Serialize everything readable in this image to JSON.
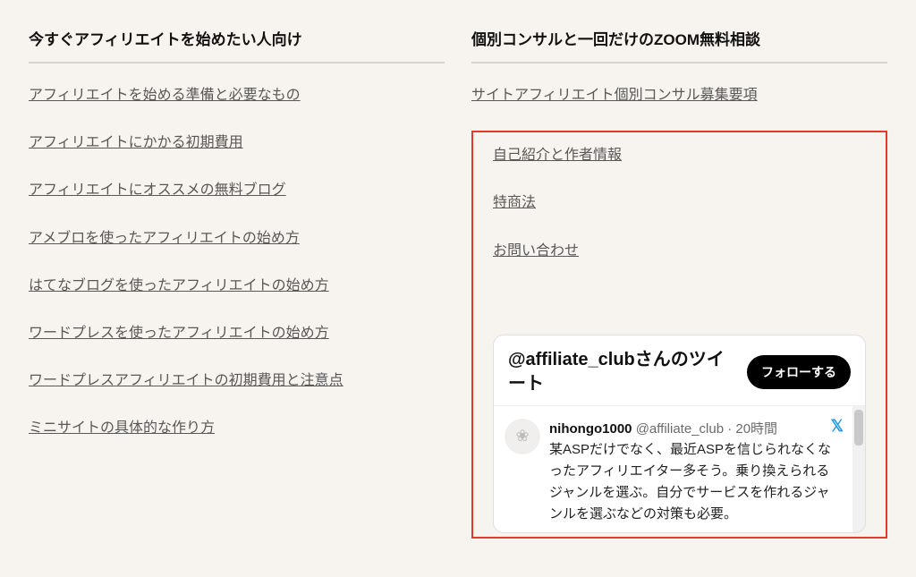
{
  "left": {
    "title": "今すぐアフィリエイトを始めたい人向け",
    "links": [
      "アフィリエイトを始める準備と必要なもの",
      "アフィリエイトにかかる初期費用",
      "アフィリエイトにオススメの無料ブログ",
      "アメブロを使ったアフィリエイトの始め方",
      "はてなブログを使ったアフィリエイトの始め方",
      "ワードプレスを使ったアフィリエイトの始め方",
      "ワードプレスアフィリエイトの初期費用と注意点",
      "ミニサイトの具体的な作り方"
    ]
  },
  "right": {
    "title": "個別コンサルと一回だけのZOOM無料相談",
    "top_link": "サイトアフィリエイト個別コンサル募集要項",
    "box_links": [
      "自己紹介と作者情報",
      "特商法",
      "お問い合わせ"
    ]
  },
  "twitter": {
    "header": "@affiliate_clubさんのツイート",
    "follow": "フォローする",
    "user": "nihongo1000",
    "handle": "@affiliate_club",
    "time": "20時間",
    "text": "某ASPだけでなく、最近ASPを信じられなくなったアフィリエイター多そう。乗り換えられるジャンルを選ぶ。自分でサービスを作れるジャンルを選ぶなどの対策も必要。"
  }
}
